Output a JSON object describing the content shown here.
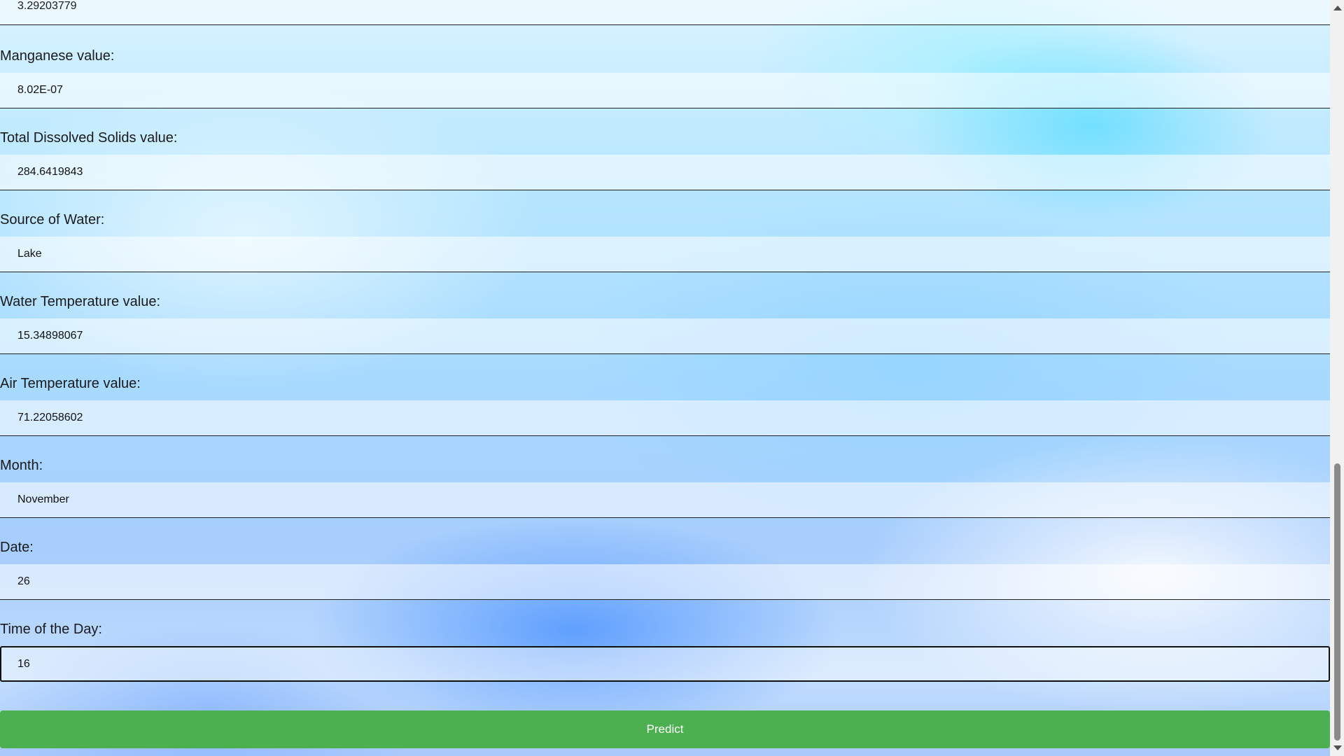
{
  "form": {
    "top_partial_value": "3.29203779",
    "fields": [
      {
        "label": "Manganese value:",
        "value": "8.02E-07"
      },
      {
        "label": "Total Dissolved Solids value:",
        "value": "284.6419843"
      },
      {
        "label": "Source of Water:",
        "value": "Lake"
      },
      {
        "label": "Water Temperature value:",
        "value": "15.34898067"
      },
      {
        "label": "Air Temperature value:",
        "value": "71.22058602"
      },
      {
        "label": "Month:",
        "value": "November"
      },
      {
        "label": "Date:",
        "value": "26"
      },
      {
        "label": "Time of the Day:",
        "value": "16"
      }
    ],
    "submit_label": "Predict"
  },
  "colors": {
    "predict_button": "#4caf50",
    "predict_text": "#ffffff"
  },
  "icons": {
    "scroll_up": "scroll-up-arrow-icon",
    "scroll_down": "scroll-down-arrow-icon"
  }
}
